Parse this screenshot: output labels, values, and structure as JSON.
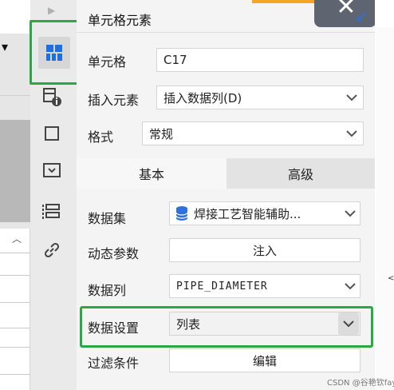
{
  "panel": {
    "title": "单元格元素"
  },
  "form": {
    "cell_label": "单元格",
    "cell_value": "C17",
    "insert_label": "插入元素",
    "insert_value": "插入数据列(D)",
    "format_label": "格式",
    "format_value": "常规"
  },
  "tabs": {
    "basic": "基本",
    "advanced": "高级"
  },
  "data_fields": {
    "dataset_label": "数据集",
    "dataset_value": "焊接工艺智能辅助...",
    "dynamic_param_label": "动态参数",
    "dynamic_param_button": "注入",
    "column_label": "数据列",
    "column_value": "PIPE_DIAMETER",
    "setting_label": "数据设置",
    "setting_value": "列表",
    "filter_label": "过滤条件",
    "filter_button": "编辑"
  },
  "right_edge": {
    "text": "<"
  },
  "watermark": "CSDN @谷艳钦faye",
  "icons": [
    "play-icon",
    "cell-grid-icon",
    "cell-info-icon",
    "border-icon",
    "dropdown-box-icon",
    "condition-icon",
    "link-icon",
    "close-icon",
    "collapse-arrow-icon",
    "chevron-down-icon",
    "database-icon"
  ],
  "colors": {
    "highlight_green": "#2aa845",
    "accent_blue": "#2f6fe0",
    "orange": "#f5a623"
  }
}
